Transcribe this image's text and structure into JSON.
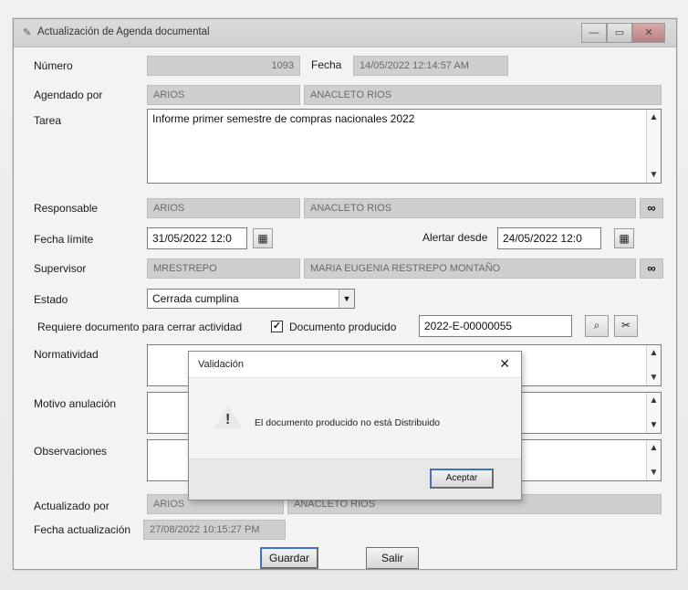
{
  "window": {
    "title": "Actualización de Agenda documental",
    "min_glyph": "—",
    "max_glyph": "▭",
    "close_glyph": "✕"
  },
  "form": {
    "numero": {
      "label": "Número",
      "value": "1093"
    },
    "fecha": {
      "label": "Fecha",
      "value": "14/05/2022 12:14:57 AM"
    },
    "agendado_por": {
      "label": "Agendado por",
      "user": "ARIOS",
      "name": "ANACLETO RIOS"
    },
    "tarea": {
      "label": "Tarea",
      "value": "Informe primer semestre de compras nacionales 2022"
    },
    "responsable": {
      "label": "Responsable",
      "user": "ARIOS",
      "name": "ANACLETO RIOS"
    },
    "fecha_limite": {
      "label": "Fecha límite",
      "value": "31/05/2022 12:0"
    },
    "alertar_desde": {
      "label": "Alertar desde",
      "value": "24/05/2022 12:0"
    },
    "supervisor": {
      "label": "Supervisor",
      "user": "MRESTREPO",
      "name": "MARIA EUGENIA RESTREPO MONTAÑO"
    },
    "estado": {
      "label": "Estado",
      "value": "Cerrada cumplina"
    },
    "requiere_doc": {
      "label": "Requiere documento para cerrar actividad",
      "checked": true
    },
    "documento_producido": {
      "label": "Documento producido",
      "value": "2022-E-00000055"
    },
    "normatividad": {
      "label": "Normatividad"
    },
    "motivo_anulacion": {
      "label": "Motivo anulación"
    },
    "observaciones": {
      "label": "Observaciones"
    },
    "actualizado_por": {
      "label": "Actualizado por",
      "user": "ARIOS",
      "name": "ANACLETO RIOS"
    },
    "fecha_actualizacion": {
      "label": "Fecha actualización",
      "value": "27/08/2022 10:15:27 PM"
    }
  },
  "buttons": {
    "guardar": "Guardar",
    "salir": "Salir"
  },
  "dialog": {
    "title": "Validación",
    "close_glyph": "✕",
    "message": "El documento producido no está Distribuido",
    "accept": "Aceptar",
    "icon": "warning-icon"
  },
  "icons": {
    "calendar": "📅",
    "binoculars": "🔭",
    "search_doc": "🔍",
    "tools": "✂"
  },
  "colors": {
    "readonly_bg": "#cfcfcf",
    "window_bg": "#f3f3f3"
  }
}
